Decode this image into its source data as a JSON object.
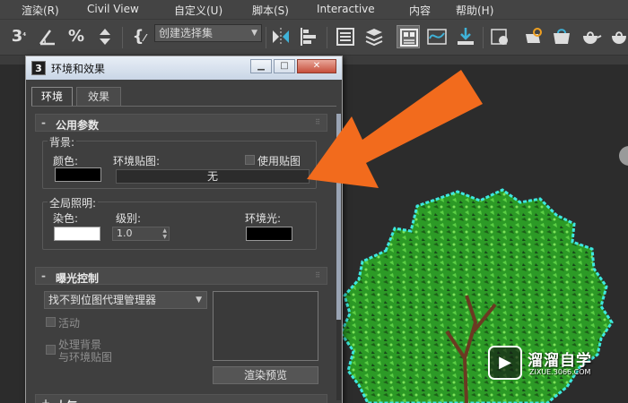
{
  "menubar": {
    "items": [
      "渲染(R)",
      "Civil View",
      "自定义(U)",
      "脚本(S)",
      "Interactive",
      "内容",
      "帮助(H)"
    ]
  },
  "toolbar": {
    "selection_set_placeholder": "创建选择集"
  },
  "dialog": {
    "title": "环境和效果",
    "app_icon_text": "3",
    "tabs": [
      "环境",
      "效果"
    ],
    "common_params": {
      "rollout_title": "公用参数",
      "sign": "-",
      "background": {
        "group_label": "背景:",
        "color_label": "颜色:",
        "env_map_label": "环境贴图:",
        "use_map_label": "使用贴图",
        "map_button": "无",
        "color": "#000000"
      },
      "global_lighting": {
        "group_label": "全局照明:",
        "tint_label": "染色:",
        "level_label": "级别:",
        "level_value": "1.0",
        "ambient_label": "环境光:",
        "tint_color": "#ffffff",
        "ambient_color": "#000000"
      }
    },
    "exposure": {
      "rollout_title": "曝光控制",
      "sign": "-",
      "dropdown_value": "找不到位图代理管理器",
      "active_label": "活动",
      "process_bg_label_1": "处理背景",
      "process_bg_label_2": "与环境贴图",
      "render_preview_button": "渲染预览"
    },
    "atmosphere": {
      "rollout_title": "大气",
      "sign": "+"
    }
  },
  "watermark": {
    "name": "溜溜自学",
    "url": "ZIXUE.3066.COM"
  },
  "colors": {
    "arrow": "#f26b1d",
    "tree_leaf": "#2fa82a",
    "tree_outline": "#3de8e0",
    "dialog_bg": "#3f3f3f"
  }
}
